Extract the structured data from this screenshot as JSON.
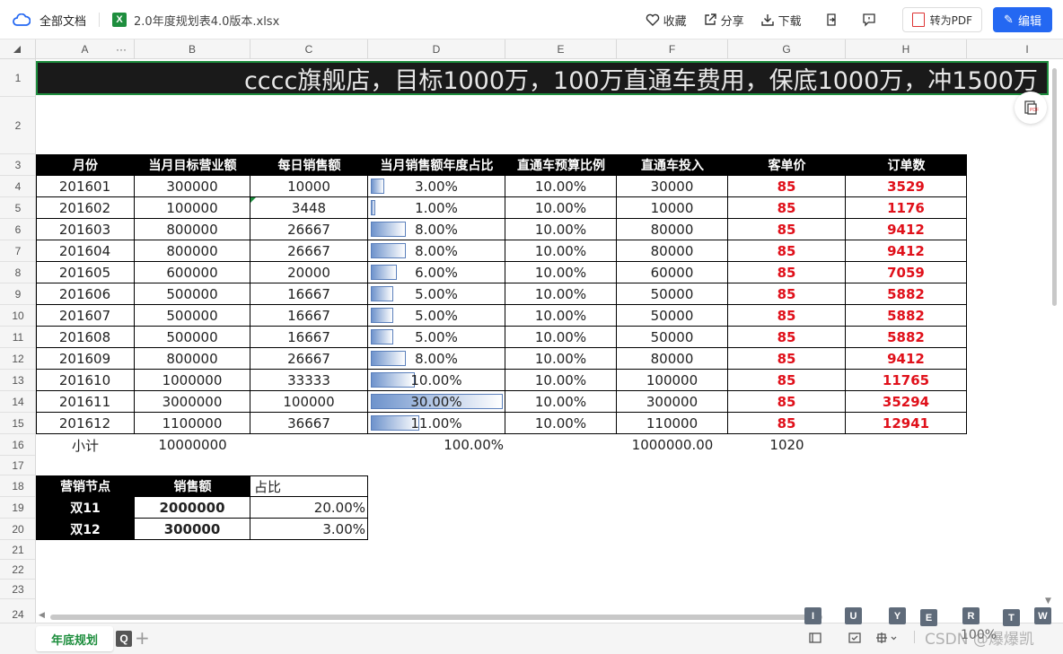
{
  "topbar": {
    "all_docs": "全部文档",
    "file_name": "2.0年度规划表4.0版本.xlsx",
    "file_icon_letter": "X",
    "actions": {
      "favorite": "收藏",
      "share": "分享",
      "download": "下载"
    },
    "to_pdf": "转为PDF",
    "edit": "编辑"
  },
  "columns": [
    "A",
    "",
    "B",
    "C",
    "D",
    "E",
    "F",
    "G",
    "H",
    "I"
  ],
  "column_overflow": "···",
  "rows": [
    "1",
    "2",
    "3",
    "4",
    "5",
    "6",
    "7",
    "8",
    "9",
    "10",
    "11",
    "12",
    "13",
    "14",
    "15",
    "16",
    "17",
    "18",
    "19",
    "20",
    "21",
    "22",
    "23",
    "24"
  ],
  "title": "cccc旗舰店，目标1000万，100万直通车费用，保底1000万，冲1500万",
  "table": {
    "headers": [
      "月份",
      "当月目标营业额",
      "每日销售额",
      "当月销售额年度占比",
      "直通车预算比例",
      "直通车投入",
      "客单价",
      "订单数"
    ],
    "rows": [
      {
        "month": "201601",
        "target": "300000",
        "daily": "10000",
        "pct": "3.00%",
        "pct_value": 3,
        "budget": "10.00%",
        "invest": "30000",
        "aov": "85",
        "orders": "3529"
      },
      {
        "month": "201602",
        "target": "100000",
        "daily": "3448",
        "pct": "1.00%",
        "pct_value": 1,
        "budget": "10.00%",
        "invest": "10000",
        "aov": "85",
        "orders": "1176"
      },
      {
        "month": "201603",
        "target": "800000",
        "daily": "26667",
        "pct": "8.00%",
        "pct_value": 8,
        "budget": "10.00%",
        "invest": "80000",
        "aov": "85",
        "orders": "9412"
      },
      {
        "month": "201604",
        "target": "800000",
        "daily": "26667",
        "pct": "8.00%",
        "pct_value": 8,
        "budget": "10.00%",
        "invest": "80000",
        "aov": "85",
        "orders": "9412"
      },
      {
        "month": "201605",
        "target": "600000",
        "daily": "20000",
        "pct": "6.00%",
        "pct_value": 6,
        "budget": "10.00%",
        "invest": "60000",
        "aov": "85",
        "orders": "7059"
      },
      {
        "month": "201606",
        "target": "500000",
        "daily": "16667",
        "pct": "5.00%",
        "pct_value": 5,
        "budget": "10.00%",
        "invest": "50000",
        "aov": "85",
        "orders": "5882"
      },
      {
        "month": "201607",
        "target": "500000",
        "daily": "16667",
        "pct": "5.00%",
        "pct_value": 5,
        "budget": "10.00%",
        "invest": "50000",
        "aov": "85",
        "orders": "5882"
      },
      {
        "month": "201608",
        "target": "500000",
        "daily": "16667",
        "pct": "5.00%",
        "pct_value": 5,
        "budget": "10.00%",
        "invest": "50000",
        "aov": "85",
        "orders": "5882"
      },
      {
        "month": "201609",
        "target": "800000",
        "daily": "26667",
        "pct": "8.00%",
        "pct_value": 8,
        "budget": "10.00%",
        "invest": "80000",
        "aov": "85",
        "orders": "9412"
      },
      {
        "month": "201610",
        "target": "1000000",
        "daily": "33333",
        "pct": "10.00%",
        "pct_value": 10,
        "budget": "10.00%",
        "invest": "100000",
        "aov": "85",
        "orders": "11765"
      },
      {
        "month": "201611",
        "target": "3000000",
        "daily": "100000",
        "pct": "30.00%",
        "pct_value": 30,
        "budget": "10.00%",
        "invest": "300000",
        "aov": "85",
        "orders": "35294"
      },
      {
        "month": "201612",
        "target": "1100000",
        "daily": "36667",
        "pct": "11.00%",
        "pct_value": 11,
        "budget": "10.00%",
        "invest": "110000",
        "aov": "85",
        "orders": "12941"
      }
    ],
    "subtotal": {
      "label": "小计",
      "target": "10000000",
      "pct": "100.00%",
      "invest": "1000000.00",
      "aov": "1020"
    }
  },
  "nodes": {
    "headers": [
      "营销节点",
      "销售额",
      "占比"
    ],
    "rows": [
      {
        "name": "双11",
        "sales": "2000000",
        "pct": "20.00%"
      },
      {
        "name": "双12",
        "sales": "300000",
        "pct": "3.00%"
      }
    ]
  },
  "sheet_tab": "年底规划",
  "sheet_tab_key": "Q",
  "key_badges": [
    "I",
    "U",
    "Y",
    "E",
    "R",
    "T",
    "W"
  ],
  "zoom": "100%",
  "watermark": "CSDN @爆爆凯",
  "colors": {
    "accent": "#2468f2",
    "tab_green": "#1e8e3e",
    "red": "#e0101a",
    "header_black": "#000000",
    "bar": "#6e93cc"
  }
}
